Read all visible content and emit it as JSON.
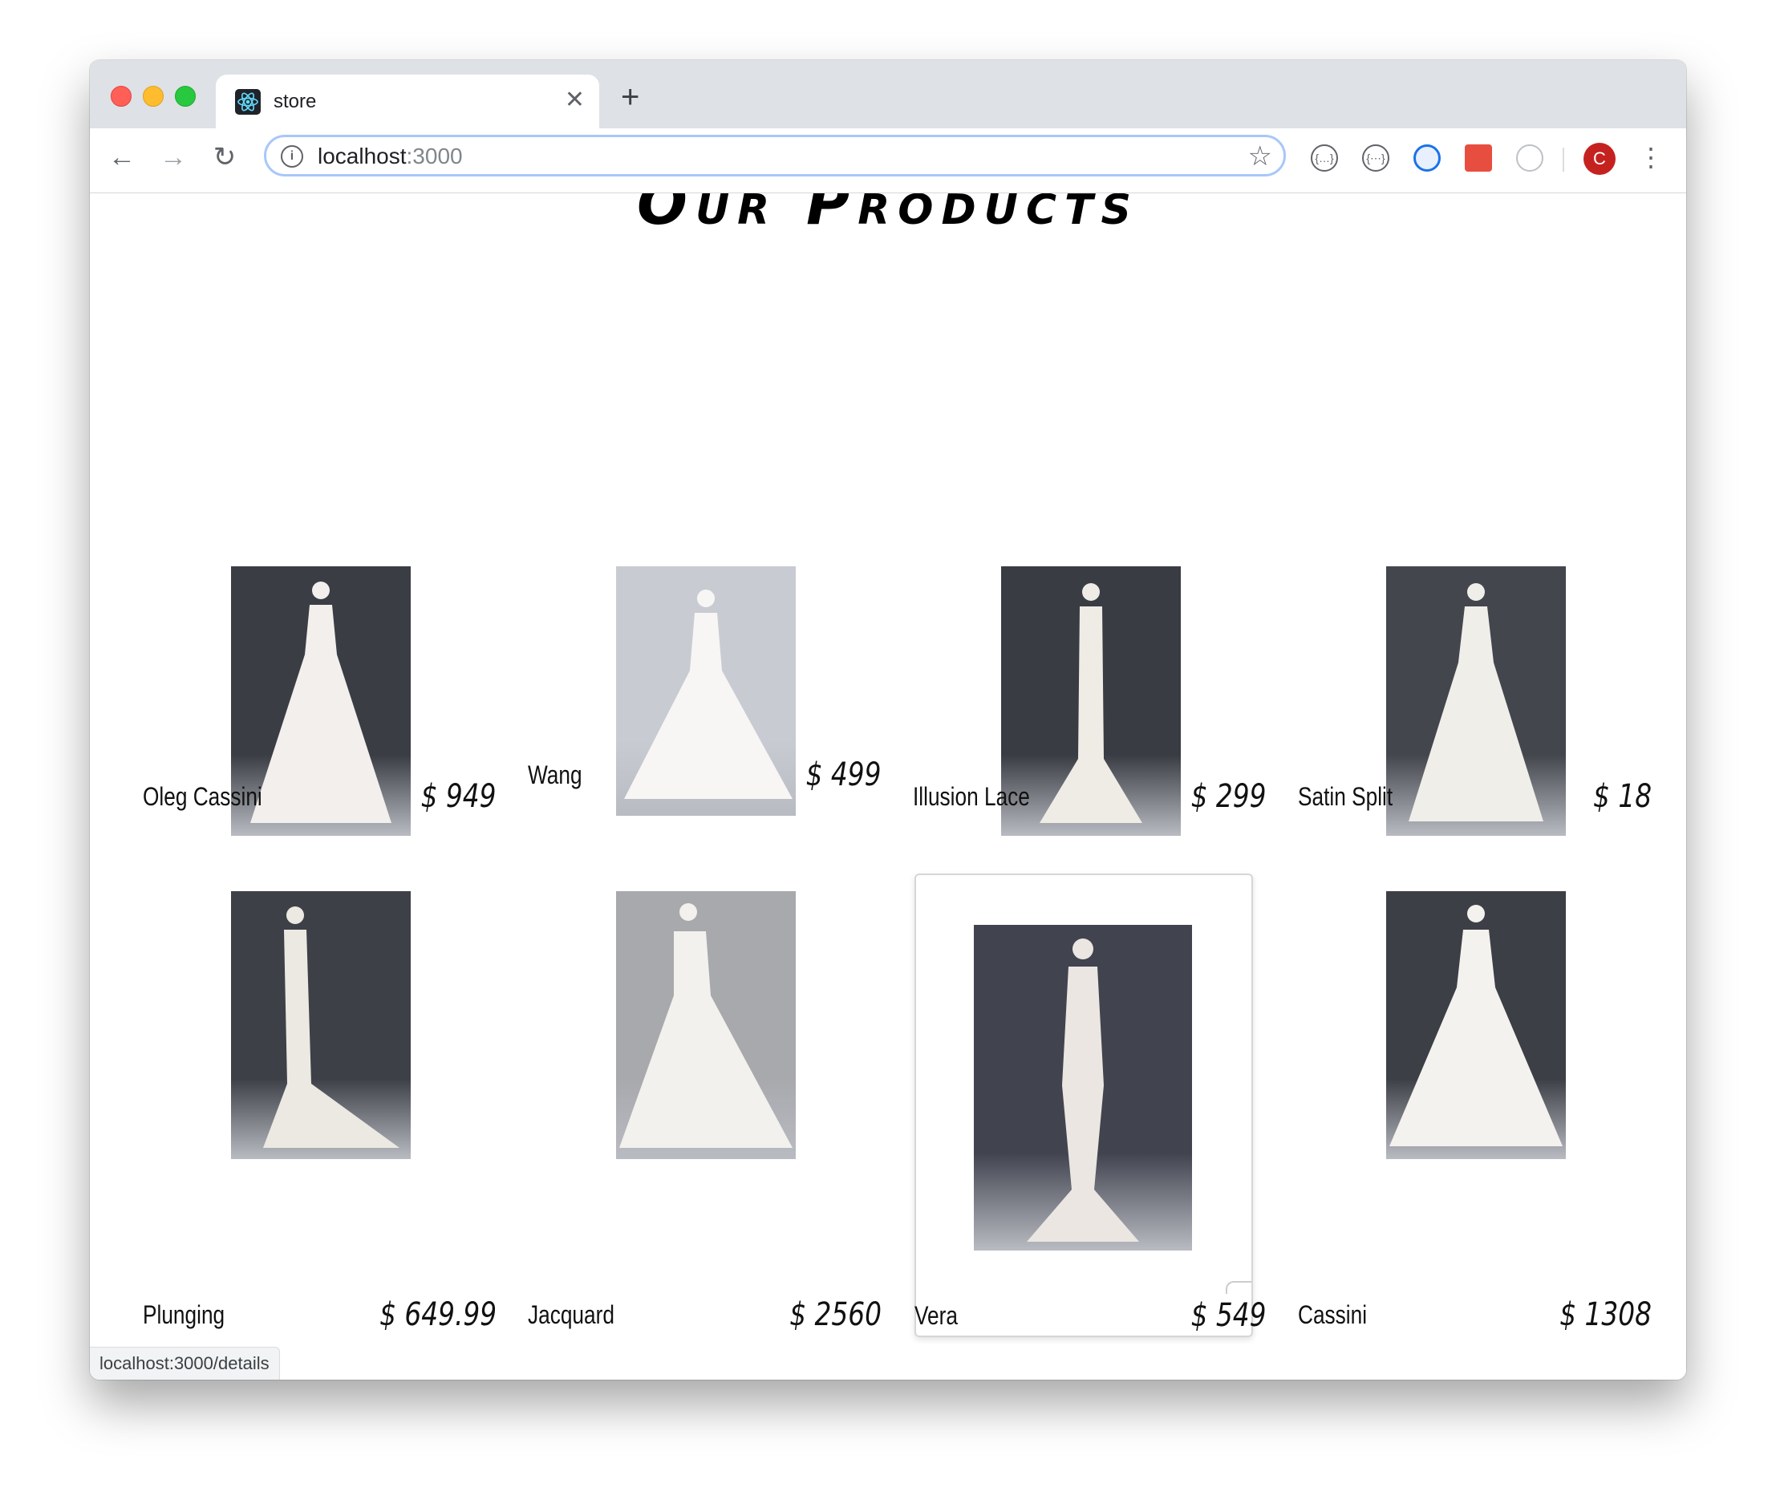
{
  "browser": {
    "tab_title": "store",
    "url_host": "localhost",
    "url_port": ":3000",
    "status_url": "localhost:3000/details",
    "avatar_initial": "C"
  },
  "page": {
    "title": "Our Products"
  },
  "products": [
    {
      "name": "Oleg Cassini",
      "price": "$ 949",
      "bg": "#3b3d45",
      "gown": "#f2efec"
    },
    {
      "name": "Wang",
      "price": "$ 499",
      "bg": "#c9cbd3",
      "gown": "#f7f6f4"
    },
    {
      "name": "Illusion Lace",
      "price": "$ 299",
      "bg": "#3a3c44",
      "gown": "#efece6"
    },
    {
      "name": "Satin Split",
      "price": "$ 18",
      "bg": "#44464e",
      "gown": "#f0eee9"
    },
    {
      "name": "Plunging",
      "price": "$ 649.99",
      "bg": "#3e4048",
      "gown": "#ece9e2"
    },
    {
      "name": "Jacquard",
      "price": "$ 2560",
      "bg": "#a8a9ad",
      "gown": "#f3f1ed"
    },
    {
      "name": "Vera",
      "price": "$ 549",
      "bg": "#41444f",
      "gown": "#ebe6e2"
    },
    {
      "name": "Cassini",
      "price": "$ 1308",
      "bg": "#3d3f46",
      "gown": "#f4f2ee"
    }
  ]
}
